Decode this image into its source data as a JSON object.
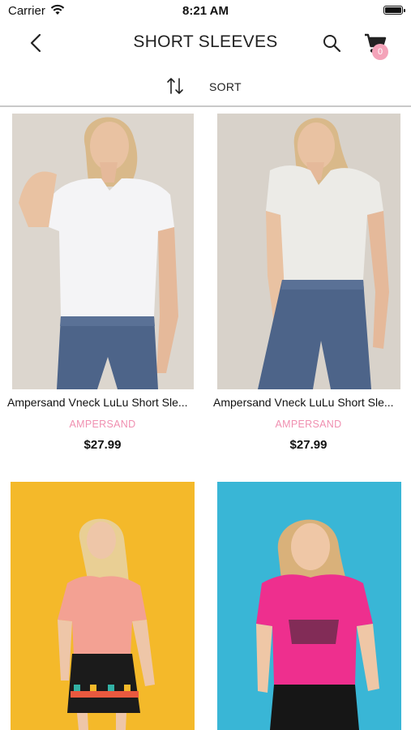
{
  "status_bar": {
    "carrier": "Carrier",
    "time": "8:21 AM"
  },
  "header": {
    "title": "SHORT SLEEVES",
    "cart_count": "0"
  },
  "sort": {
    "label": "SORT"
  },
  "products": [
    {
      "name": "Ampersand Vneck LuLu Short Sle...",
      "brand": "AMPERSAND",
      "price": "$27.99"
    },
    {
      "name": "Ampersand Vneck LuLu Short Sle...",
      "brand": "AMPERSAND",
      "price": "$27.99"
    },
    {
      "name": "",
      "brand": "",
      "price": ""
    },
    {
      "name": "",
      "brand": "",
      "price": ""
    }
  ],
  "colors": {
    "brand_pink": "#f08fb0",
    "badge_pink": "#f4a3b9",
    "yellow_bg": "#f4b92a",
    "blue_bg": "#39b6d6"
  },
  "icons": [
    "wifi-icon",
    "battery-icon",
    "back-chevron-icon",
    "search-icon",
    "cart-icon",
    "sort-arrows-icon"
  ]
}
